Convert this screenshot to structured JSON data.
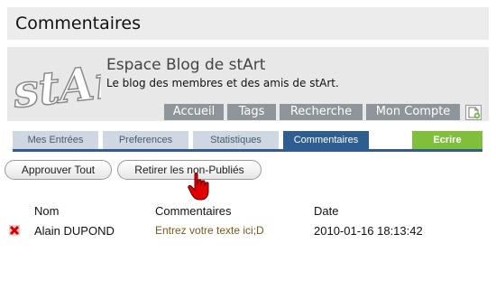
{
  "page": {
    "title": "Commentaires"
  },
  "header": {
    "logo_text": "stArt",
    "blog_title": "Espace Blog de stArt",
    "blog_subtitle": "Le blog des membres et des amis de stArt."
  },
  "top_nav": [
    {
      "label": "Accueil"
    },
    {
      "label": "Tags"
    },
    {
      "label": "Recherche"
    },
    {
      "label": "Mon Compte"
    }
  ],
  "sub_nav": [
    {
      "label": "Mes Entrées"
    },
    {
      "label": "Preferences"
    },
    {
      "label": "Statistiques"
    },
    {
      "label": "Commentaires",
      "active": true
    },
    {
      "label": "Ecrire"
    }
  ],
  "actions": {
    "approve_all": "Approuver Tout",
    "remove_unpublished": "Retirer les non-Publiés"
  },
  "table": {
    "headers": [
      "Nom",
      "Commentaires",
      "Date"
    ],
    "rows": [
      {
        "nom": "Alain DUPOND",
        "commentaire": "Entrez votre texte ici;D",
        "date": "2010-01-16 18:13:42"
      }
    ]
  },
  "colors": {
    "active_tab": "#2e5d8f",
    "inactive_tab": "#cfd8e2",
    "write_tab": "#7fbf3a",
    "top_tab": "#8e959b",
    "comment_text": "#7a5a1a",
    "delete_icon": "#d40000"
  },
  "icons": [
    "stArt-logo",
    "new-document-icon",
    "delete-icon",
    "hand-pointer-cursor"
  ]
}
